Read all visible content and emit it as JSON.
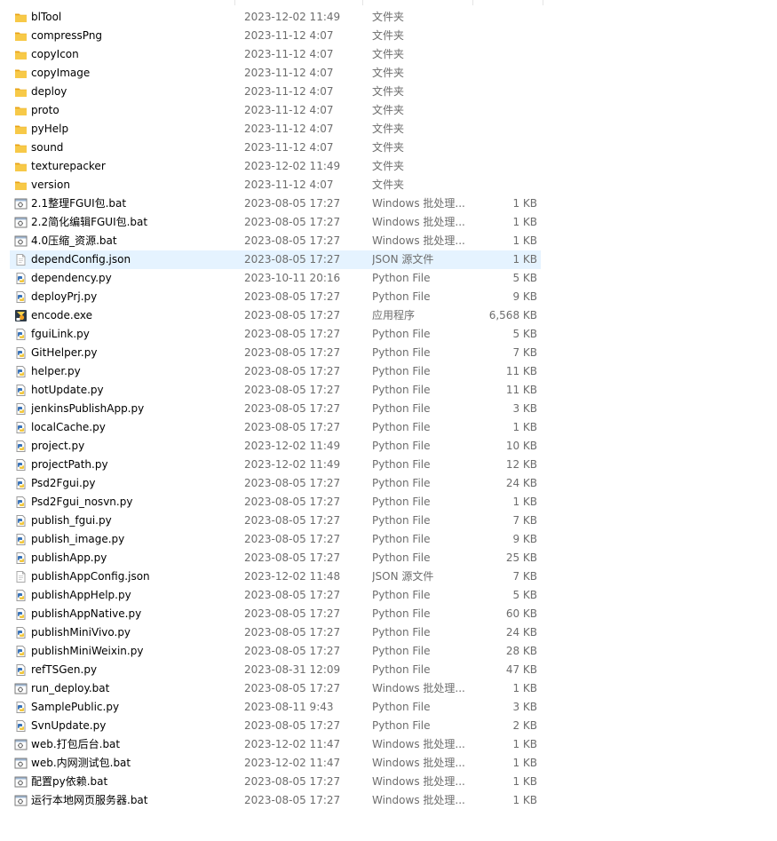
{
  "files": [
    {
      "name": "blTool",
      "modified": "2023-12-02 11:49",
      "type": "文件夹",
      "size": "",
      "icon": "folder-icon"
    },
    {
      "name": "compressPng",
      "modified": "2023-11-12 4:07",
      "type": "文件夹",
      "size": "",
      "icon": "folder-icon"
    },
    {
      "name": "copyIcon",
      "modified": "2023-11-12 4:07",
      "type": "文件夹",
      "size": "",
      "icon": "folder-icon"
    },
    {
      "name": "copyImage",
      "modified": "2023-11-12 4:07",
      "type": "文件夹",
      "size": "",
      "icon": "folder-icon"
    },
    {
      "name": "deploy",
      "modified": "2023-11-12 4:07",
      "type": "文件夹",
      "size": "",
      "icon": "folder-icon"
    },
    {
      "name": "proto",
      "modified": "2023-11-12 4:07",
      "type": "文件夹",
      "size": "",
      "icon": "folder-icon"
    },
    {
      "name": "pyHelp",
      "modified": "2023-11-12 4:07",
      "type": "文件夹",
      "size": "",
      "icon": "folder-icon"
    },
    {
      "name": "sound",
      "modified": "2023-11-12 4:07",
      "type": "文件夹",
      "size": "",
      "icon": "folder-icon"
    },
    {
      "name": "texturepacker",
      "modified": "2023-12-02 11:49",
      "type": "文件夹",
      "size": "",
      "icon": "folder-icon"
    },
    {
      "name": "version",
      "modified": "2023-11-12 4:07",
      "type": "文件夹",
      "size": "",
      "icon": "folder-icon"
    },
    {
      "name": "2.1整理FGUI包.bat",
      "modified": "2023-08-05 17:27",
      "type": "Windows 批处理...",
      "size": "1 KB",
      "icon": "batch-file-icon"
    },
    {
      "name": "2.2简化编辑FGUI包.bat",
      "modified": "2023-08-05 17:27",
      "type": "Windows 批处理...",
      "size": "1 KB",
      "icon": "batch-file-icon"
    },
    {
      "name": "4.0压缩_资源.bat",
      "modified": "2023-08-05 17:27",
      "type": "Windows 批处理...",
      "size": "1 KB",
      "icon": "batch-file-icon"
    },
    {
      "name": "dependConfig.json",
      "modified": "2023-08-05 17:27",
      "type": "JSON 源文件",
      "size": "1 KB",
      "icon": "json-file-icon",
      "selected": true
    },
    {
      "name": "dependency.py",
      "modified": "2023-10-11 20:16",
      "type": "Python File",
      "size": "5 KB",
      "icon": "python-file-icon"
    },
    {
      "name": "deployPrj.py",
      "modified": "2023-08-05 17:27",
      "type": "Python File",
      "size": "9 KB",
      "icon": "python-file-icon"
    },
    {
      "name": "encode.exe",
      "modified": "2023-08-05 17:27",
      "type": "应用程序",
      "size": "6,568 KB",
      "icon": "executable-icon"
    },
    {
      "name": "fguiLink.py",
      "modified": "2023-08-05 17:27",
      "type": "Python File",
      "size": "5 KB",
      "icon": "python-file-icon"
    },
    {
      "name": "GitHelper.py",
      "modified": "2023-08-05 17:27",
      "type": "Python File",
      "size": "7 KB",
      "icon": "python-file-icon"
    },
    {
      "name": "helper.py",
      "modified": "2023-08-05 17:27",
      "type": "Python File",
      "size": "11 KB",
      "icon": "python-file-icon"
    },
    {
      "name": "hotUpdate.py",
      "modified": "2023-08-05 17:27",
      "type": "Python File",
      "size": "11 KB",
      "icon": "python-file-icon"
    },
    {
      "name": "jenkinsPublishApp.py",
      "modified": "2023-08-05 17:27",
      "type": "Python File",
      "size": "3 KB",
      "icon": "python-file-icon"
    },
    {
      "name": "localCache.py",
      "modified": "2023-08-05 17:27",
      "type": "Python File",
      "size": "1 KB",
      "icon": "python-file-icon"
    },
    {
      "name": "project.py",
      "modified": "2023-12-02 11:49",
      "type": "Python File",
      "size": "10 KB",
      "icon": "python-file-icon"
    },
    {
      "name": "projectPath.py",
      "modified": "2023-12-02 11:49",
      "type": "Python File",
      "size": "12 KB",
      "icon": "python-file-icon"
    },
    {
      "name": "Psd2Fgui.py",
      "modified": "2023-08-05 17:27",
      "type": "Python File",
      "size": "24 KB",
      "icon": "python-file-icon"
    },
    {
      "name": "Psd2Fgui_nosvn.py",
      "modified": "2023-08-05 17:27",
      "type": "Python File",
      "size": "1 KB",
      "icon": "python-file-icon"
    },
    {
      "name": "publish_fgui.py",
      "modified": "2023-08-05 17:27",
      "type": "Python File",
      "size": "7 KB",
      "icon": "python-file-icon"
    },
    {
      "name": "publish_image.py",
      "modified": "2023-08-05 17:27",
      "type": "Python File",
      "size": "9 KB",
      "icon": "python-file-icon"
    },
    {
      "name": "publishApp.py",
      "modified": "2023-08-05 17:27",
      "type": "Python File",
      "size": "25 KB",
      "icon": "python-file-icon"
    },
    {
      "name": "publishAppConfig.json",
      "modified": "2023-12-02 11:48",
      "type": "JSON 源文件",
      "size": "7 KB",
      "icon": "json-file-icon"
    },
    {
      "name": "publishAppHelp.py",
      "modified": "2023-08-05 17:27",
      "type": "Python File",
      "size": "5 KB",
      "icon": "python-file-icon"
    },
    {
      "name": "publishAppNative.py",
      "modified": "2023-08-05 17:27",
      "type": "Python File",
      "size": "60 KB",
      "icon": "python-file-icon"
    },
    {
      "name": "publishMiniVivo.py",
      "modified": "2023-08-05 17:27",
      "type": "Python File",
      "size": "24 KB",
      "icon": "python-file-icon"
    },
    {
      "name": "publishMiniWeixin.py",
      "modified": "2023-08-05 17:27",
      "type": "Python File",
      "size": "28 KB",
      "icon": "python-file-icon"
    },
    {
      "name": "refTSGen.py",
      "modified": "2023-08-31 12:09",
      "type": "Python File",
      "size": "47 KB",
      "icon": "python-file-icon"
    },
    {
      "name": "run_deploy.bat",
      "modified": "2023-08-05 17:27",
      "type": "Windows 批处理...",
      "size": "1 KB",
      "icon": "batch-file-icon"
    },
    {
      "name": "SamplePublic.py",
      "modified": "2023-08-11 9:43",
      "type": "Python File",
      "size": "3 KB",
      "icon": "python-file-icon"
    },
    {
      "name": "SvnUpdate.py",
      "modified": "2023-08-05 17:27",
      "type": "Python File",
      "size": "2 KB",
      "icon": "python-file-icon"
    },
    {
      "name": "web.打包后台.bat",
      "modified": "2023-12-02 11:47",
      "type": "Windows 批处理...",
      "size": "1 KB",
      "icon": "batch-file-icon"
    },
    {
      "name": "web.内网测试包.bat",
      "modified": "2023-12-02 11:47",
      "type": "Windows 批处理...",
      "size": "1 KB",
      "icon": "batch-file-icon"
    },
    {
      "name": "配置py依赖.bat",
      "modified": "2023-08-05 17:27",
      "type": "Windows 批处理...",
      "size": "1 KB",
      "icon": "batch-file-icon"
    },
    {
      "name": "运行本地网页服务器.bat",
      "modified": "2023-08-05 17:27",
      "type": "Windows 批处理...",
      "size": "1 KB",
      "icon": "batch-file-icon"
    }
  ],
  "colors": {
    "selected_row": "#e5f3ff",
    "folder": "#f7c948",
    "python_blue": "#3a73b8",
    "python_yellow": "#f2c73b",
    "secondary_text": "#6d6d6d"
  }
}
